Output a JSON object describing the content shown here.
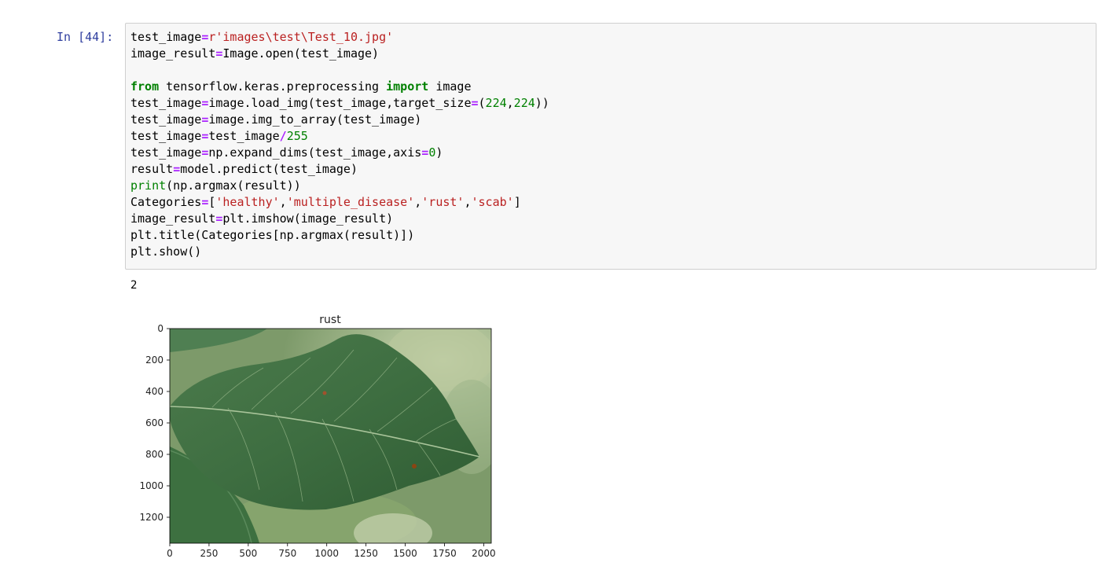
{
  "cell": {
    "prompt": "In [44]:",
    "code_lines": [
      [
        [
          "n",
          "test_image"
        ],
        [
          "o",
          "="
        ],
        [
          "s",
          "r'images\\test\\Test_10.jpg'"
        ]
      ],
      [
        [
          "n",
          "image_result"
        ],
        [
          "o",
          "="
        ],
        [
          "n",
          "Image.open(test_image)"
        ]
      ],
      [],
      [
        [
          "k",
          "from"
        ],
        [
          "n",
          " tensorflow.keras.preprocessing "
        ],
        [
          "k",
          "import"
        ],
        [
          "n",
          " image"
        ]
      ],
      [
        [
          "n",
          "test_image"
        ],
        [
          "o",
          "="
        ],
        [
          "n",
          "image.load_img(test_image,target_size"
        ],
        [
          "o",
          "="
        ],
        [
          "n",
          "("
        ],
        [
          "num",
          "224"
        ],
        [
          "n",
          ","
        ],
        [
          "num",
          "224"
        ],
        [
          "n",
          "))"
        ]
      ],
      [
        [
          "n",
          "test_image"
        ],
        [
          "o",
          "="
        ],
        [
          "n",
          "image.img_to_array(test_image)"
        ]
      ],
      [
        [
          "n",
          "test_image"
        ],
        [
          "o",
          "="
        ],
        [
          "n",
          "test_image"
        ],
        [
          "o",
          "/"
        ],
        [
          "num",
          "255"
        ]
      ],
      [
        [
          "n",
          "test_image"
        ],
        [
          "o",
          "="
        ],
        [
          "n",
          "np.expand_dims(test_image,axis"
        ],
        [
          "o",
          "="
        ],
        [
          "num",
          "0"
        ],
        [
          "n",
          ")"
        ]
      ],
      [
        [
          "n",
          "result"
        ],
        [
          "o",
          "="
        ],
        [
          "n",
          "model.predict(test_image)"
        ]
      ],
      [
        [
          "b",
          "print"
        ],
        [
          "n",
          "(np.argmax(result))"
        ]
      ],
      [
        [
          "n",
          "Categories"
        ],
        [
          "o",
          "="
        ],
        [
          "n",
          "["
        ],
        [
          "s",
          "'healthy'"
        ],
        [
          "n",
          ","
        ],
        [
          "s",
          "'multiple_disease'"
        ],
        [
          "n",
          ","
        ],
        [
          "s",
          "'rust'"
        ],
        [
          "n",
          ","
        ],
        [
          "s",
          "'scab'"
        ],
        [
          "n",
          "]"
        ]
      ],
      [
        [
          "n",
          "image_result"
        ],
        [
          "o",
          "="
        ],
        [
          "n",
          "plt.imshow(image_result)"
        ]
      ],
      [
        [
          "n",
          "plt.title(Categories[np.argmax(result)])"
        ]
      ],
      [
        [
          "n",
          "plt.show()"
        ]
      ]
    ]
  },
  "output": {
    "stream_text": "2",
    "figure": {
      "title": "rust",
      "x_ticks": [
        "0",
        "250",
        "500",
        "750",
        "1000",
        "1250",
        "1500",
        "1750",
        "2000"
      ],
      "y_ticks": [
        "0",
        "200",
        "400",
        "600",
        "800",
        "1000",
        "1200"
      ],
      "x_range": [
        0,
        2048
      ],
      "y_range": [
        0,
        1365
      ],
      "image_subject": "leaf-photo"
    }
  }
}
